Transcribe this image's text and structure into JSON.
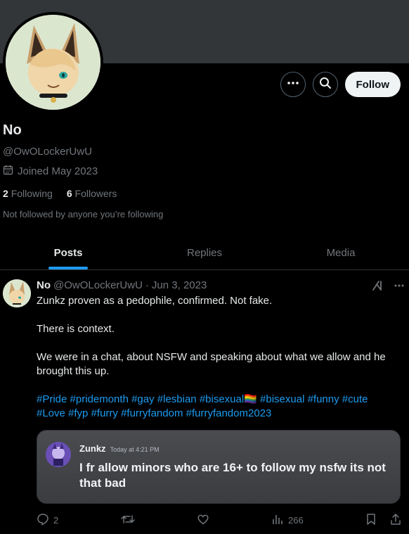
{
  "profile": {
    "name": "No",
    "handle": "@OwOLockerUwU",
    "joined": "Joined May 2023",
    "following_count": "2",
    "following_label": "Following",
    "followers_count": "6",
    "followers_label": "Followers",
    "not_followed": "Not followed by anyone you’re following"
  },
  "actions": {
    "follow_label": "Follow"
  },
  "tabs": [
    {
      "label": "Posts"
    },
    {
      "label": "Replies"
    },
    {
      "label": "Media"
    }
  ],
  "tweet": {
    "name": "No",
    "handle": "@OwOLockerUwU",
    "separator": "·",
    "date": "Jun 3, 2023",
    "line1": "Zunkz proven as a pedophile,  confirmed. Not fake.",
    "line2": "There is context.",
    "line3": "We were in a chat, about NSFW and speaking about what we allow and he brought this up.",
    "hashtags_1": "#Pride #pridemonth #gay #lesbian #bisexual🏳️‍🌈 #bisexual #funny #cute",
    "hashtags_2": "#Love #fyp #furry #furryfandom #furryfandom2023",
    "media": {
      "username": "Zunkz",
      "time": "Today at 4:21 PM",
      "message": "I fr allow minors who are 16+ to follow my nsfw its not that bad"
    },
    "replies": "2",
    "views": "266"
  },
  "colors": {
    "accent": "#1d9bf0",
    "background": "#000000",
    "muted": "#71767b",
    "banner": "#333639"
  }
}
